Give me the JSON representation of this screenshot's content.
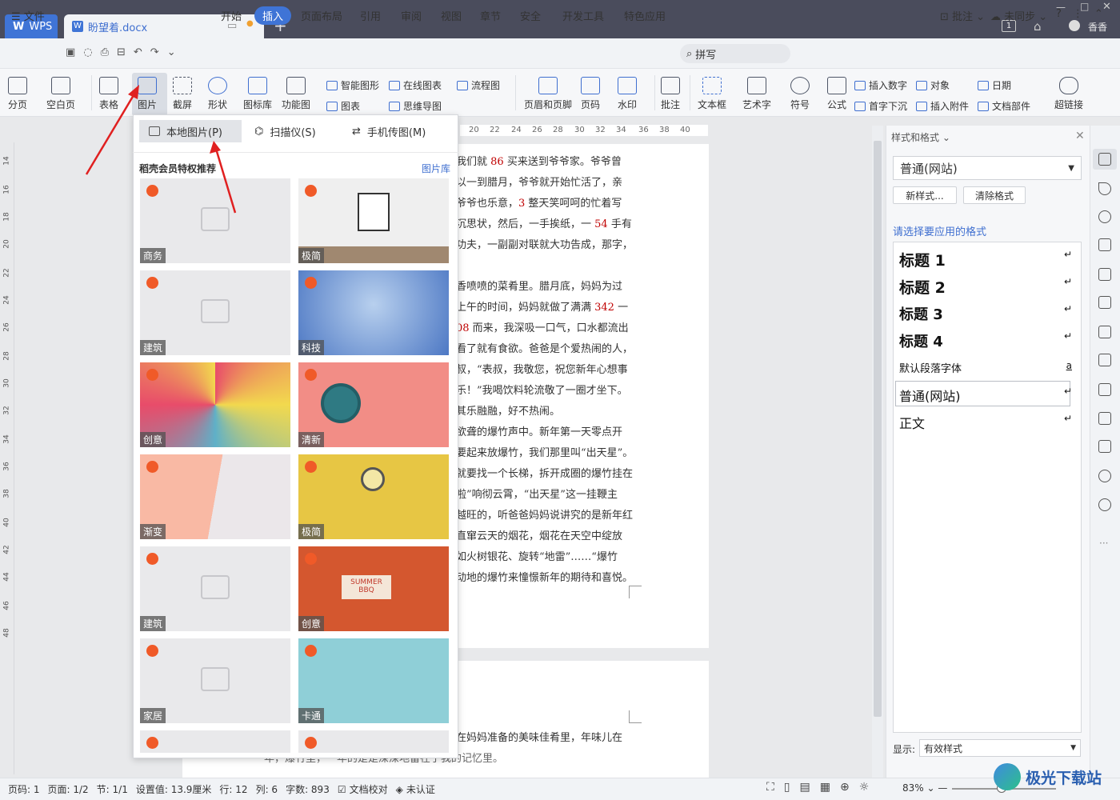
{
  "titlebar": {
    "app": "WPS",
    "doc_tab": "盼望着.docx",
    "user": "香香",
    "page_badge": "1"
  },
  "menubar": {
    "file": "文件",
    "items": [
      "开始",
      "插入",
      "页面布局",
      "引用",
      "审阅",
      "视图",
      "章节",
      "安全",
      "开发工具",
      "特色应用"
    ],
    "active": "插入",
    "search": "拼写",
    "annotate": "批注",
    "sync": "未同步"
  },
  "ribbon": {
    "page_break": "分页",
    "blank_page": "空白页",
    "table": "表格",
    "picture": "图片",
    "screenshot": "截屏",
    "shape": "形状",
    "icon_lib": "图标库",
    "func_chart": "功能图",
    "smart_art": "智能图形",
    "online_chart": "在线图表",
    "flowchart": "流程图",
    "chart": "图表",
    "mindmap": "思维导图",
    "header_footer": "页眉和页脚",
    "page_num": "页码",
    "watermark": "水印",
    "comment": "批注",
    "textbox": "文本框",
    "art_text": "艺术字",
    "symbol": "符号",
    "formula": "公式",
    "insert_number": "插入数字",
    "drop_cap": "首字下沉",
    "object": "对象",
    "attachment": "插入附件",
    "date": "日期",
    "doc_part": "文档部件",
    "hyperlink": "超链接"
  },
  "ruler": {
    "ticks": [
      "20",
      "22",
      "24",
      "26",
      "28",
      "30",
      "32",
      "34",
      "36",
      "38",
      "40"
    ],
    "left": [
      "14",
      "16",
      "18",
      "20",
      "22",
      "24",
      "26",
      "28",
      "30",
      "32",
      "34",
      "36",
      "38",
      "40",
      "42",
      "44",
      "46",
      "48"
    ]
  },
  "popup": {
    "local": "本地图片(P)",
    "scanner": "扫描仪(S)",
    "phone": "手机传图(M)",
    "section_title": "稻壳会员特权推荐",
    "library_link": "图片库",
    "thumbs": [
      {
        "label": "商务",
        "kind": "placeholder"
      },
      {
        "label": "极简",
        "kind": "frame"
      },
      {
        "label": "建筑",
        "kind": "placeholder"
      },
      {
        "label": "科技",
        "kind": "tech"
      },
      {
        "label": "创意",
        "kind": "colorful"
      },
      {
        "label": "清新",
        "kind": "clock"
      },
      {
        "label": "渐变",
        "kind": "gradient"
      },
      {
        "label": "极简",
        "kind": "magnifier"
      },
      {
        "label": "建筑",
        "kind": "placeholder"
      },
      {
        "label": "创意",
        "kind": "bbq"
      },
      {
        "label": "家居",
        "kind": "placeholder"
      },
      {
        "label": "卡通",
        "kind": "cartoon"
      }
    ],
    "bbq_text": "SUMMER BBQ"
  },
  "document": {
    "lines": [
      [
        "我们就 ",
        "86",
        " 买来送到爷爷家。爷爷曾"
      ],
      [
        "以一到腊月，爷爷就开始忙活了，亲"
      ],
      [
        "爷爷也乐意，",
        "3",
        " 整天笑呵呵的忙着写"
      ],
      [
        "沉思状，然后，一手挨纸，一 ",
        "54",
        " 手有"
      ],
      [
        "功夫，一副副对联就大功告成，那字，"
      ],
      [
        ""
      ],
      [
        "香喷喷的菜肴里。腊月底，妈妈为过"
      ],
      [
        "上午的时间，妈妈就做了满满 ",
        "342",
        " 一"
      ],
      [
        "",
        "08",
        " 而来，我深吸一口气，口水都流出"
      ],
      [
        "看了就有食欲。爸爸是个爱热闹的人，"
      ],
      [
        "叔，“表叔，我敬您，祝您新年心想事"
      ],
      [
        "乐！”我喝饮料轮流敬了一圈才坐下。"
      ],
      [
        "其乐融融，好不热闹。"
      ],
      [
        "欲聋的爆竹声中。新年第一天零点开"
      ],
      [
        "要起来放爆竹，我们那里叫“出天星”。"
      ],
      [
        "就要找一个长梯，拆开成圈的爆竹挂在"
      ],
      [
        "啦”响彻云霄，“出天星”这一挂鞭主"
      ],
      [
        "越旺的，听爸爸妈妈说讲究的是新年红"
      ],
      [
        "直窜云天的烟花，烟花在天空中绽放"
      ],
      [
        "如火树银花、旋转“地雷”……“爆竹"
      ],
      [
        "动地的爆竹来憧憬新年的期待和喜悦。"
      ]
    ],
    "page2_line1": "在妈妈准备的美味佳肴里，年味儿在",
    "page2_line2": "年，爆竹里，一年的是是深深地留在了我的记忆里。"
  },
  "sidepanel": {
    "title": "样式和格式",
    "current": "普通(网站)",
    "new_style": "新样式...",
    "clear": "清除格式",
    "prompt": "请选择要应用的格式",
    "styles": [
      {
        "name": "标题  1",
        "mark": "↵"
      },
      {
        "name": "标题  2",
        "mark": "↵"
      },
      {
        "name": "标题  3",
        "mark": "↵"
      },
      {
        "name": "标题  4",
        "mark": "↵"
      },
      {
        "name": "默认段落字体",
        "mark": "a"
      },
      {
        "name": "普通(网站)",
        "mark": "↵"
      },
      {
        "name": "正文",
        "mark": "↵"
      }
    ],
    "show_label": "显示:",
    "show_value": "有效样式"
  },
  "status": {
    "page_code": "页码: 1",
    "pages": "页面: 1/2",
    "section": "节: 1/1",
    "setting": "设置值: 13.9厘米",
    "row": "行: 12",
    "col": "列: 6",
    "words": "字数: 893",
    "proof": "文档校对",
    "cert": "未认证",
    "zoom": "83%"
  },
  "watermark_logo": "极光下载站",
  "colors": {
    "accent": "#3f74d6",
    "titlebar": "#4a4c5c",
    "arrow": "#e02020",
    "badge": "#f05a28"
  }
}
